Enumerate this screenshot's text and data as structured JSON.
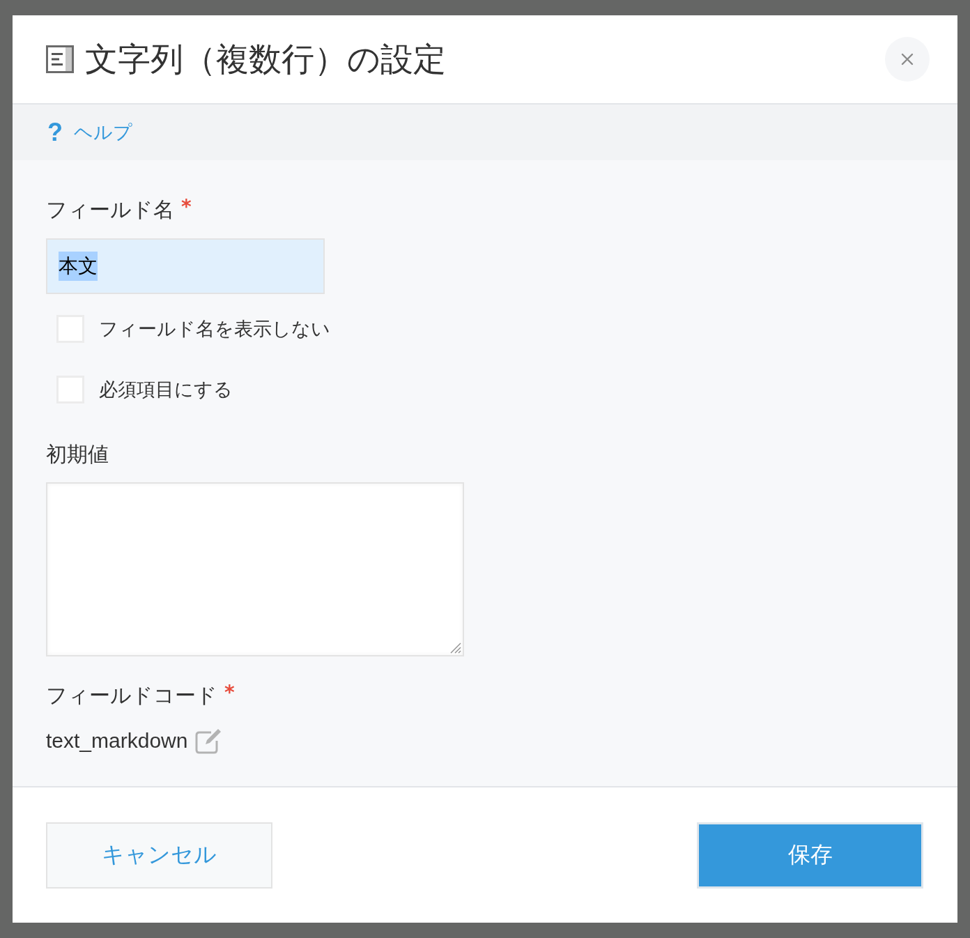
{
  "dialog": {
    "title": "文字列（複数行）の設定",
    "help_link": {
      "icon": "?",
      "label": "ヘルプ"
    },
    "field_name": {
      "label": "フィールド名",
      "required_mark": "*",
      "value": "本文",
      "focused": true,
      "text_selected": true
    },
    "options": [
      {
        "label": "フィールド名を表示しない",
        "checked": false
      },
      {
        "label": "必須項目にする",
        "checked": false
      }
    ],
    "default_value": {
      "label": "初期値"
    },
    "field_code": {
      "label": "フィールドコード",
      "required_mark": "*",
      "value": "text_markdown"
    },
    "buttons": [
      {
        "label": "キャンセル",
        "kind": "secondary"
      },
      {
        "label": "保存",
        "kind": "primary"
      }
    ]
  }
}
